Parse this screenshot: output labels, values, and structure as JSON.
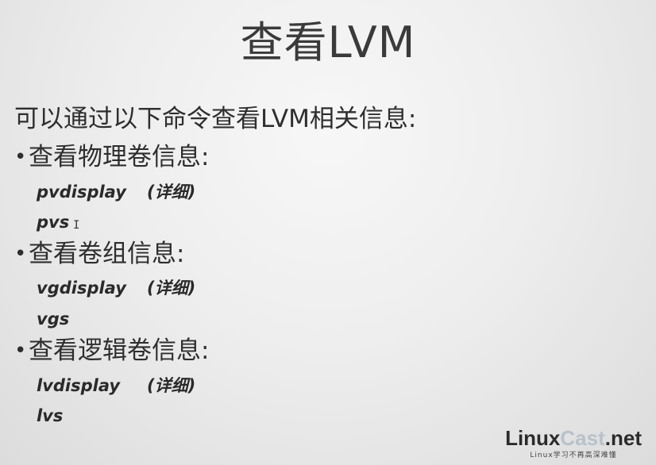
{
  "slide": {
    "title": "查看LVM",
    "intro": "可以通过以下命令查看LVM相关信息:",
    "bullet_glyph": "•",
    "sections": [
      {
        "heading": "查看物理卷信息:",
        "commands": [
          {
            "cmd": "pvdisplay",
            "note": "(详细)"
          },
          {
            "cmd": "pvs",
            "note": ""
          }
        ]
      },
      {
        "heading": "查看卷组信息:",
        "commands": [
          {
            "cmd": "vgdisplay",
            "note": "(详细)"
          },
          {
            "cmd": "vgs",
            "note": ""
          }
        ]
      },
      {
        "heading": "查看逻辑卷信息:",
        "commands": [
          {
            "cmd": "lvdisplay",
            "note": "(详细)"
          },
          {
            "cmd": "lvs",
            "note": ""
          }
        ]
      }
    ],
    "cursor_glyph": "I"
  },
  "logo": {
    "part1": "Linux",
    "part2": "Cast",
    "part3": ".net",
    "tagline": "Linux学习不再高深难懂"
  }
}
